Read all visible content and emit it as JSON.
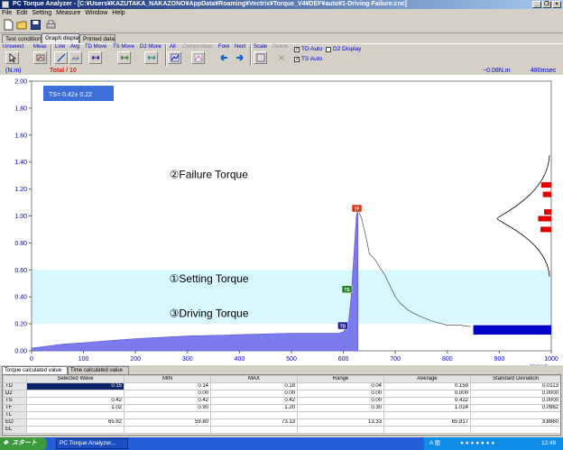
{
  "window": {
    "title": "PC Torque Analyzer - [C:¥Users¥KAZUTAKA_NAKAZONO¥AppData¥Roaming¥Vectrix¥Torque_V4¥DEF¥auto¥1-Driving-Failure.cnc]",
    "minimize": "_",
    "restore": "❐",
    "close": "×"
  },
  "menu": [
    "File",
    "Edit",
    "Setting",
    "Measure",
    "Window",
    "Help"
  ],
  "tabs": [
    {
      "label": "Test condition",
      "active": false
    },
    {
      "label": "Graph display",
      "active": true
    },
    {
      "label": "Printed data",
      "active": false
    }
  ],
  "toolbar2": {
    "unselect": "Unselect",
    "meas": "Meas",
    "line": "Line",
    "avg": "Avg",
    "td_move": "TD Move",
    "ts_move": "TS Move",
    "d2_move": "D2 Move",
    "all": "All",
    "composition": "Composition",
    "fore": "Fore",
    "next": "Next",
    "scale": "Scale",
    "delete": "Delete",
    "td_auto": "TD Auto",
    "d2_display": "D2 Display",
    "ts_auto": "TS Auto"
  },
  "status": {
    "unit": "(N.m)",
    "total": "Total / 10",
    "torque_readout": "−0.08N.m",
    "time_readout": "480msec"
  },
  "chart_data": {
    "type": "area",
    "y_ticks": [
      "2.00",
      "1.80",
      "1.60",
      "1.40",
      "1.20",
      "1.00",
      "0.80",
      "0.60",
      "0.40",
      "0.20",
      "0.00"
    ],
    "x_ticks": [
      "0",
      "100",
      "200",
      "300",
      "400",
      "500",
      "600",
      "700",
      "800",
      "900",
      "1000"
    ],
    "xlim": [
      0,
      1000
    ],
    "ylim": [
      0,
      2
    ],
    "xunit": "(msec)",
    "ts_box_text": "TS=  0.42±  0.22",
    "band": {
      "ymin": 0.2,
      "ymax": 0.6
    },
    "series_fill": [
      [
        0,
        0.02
      ],
      [
        20,
        0.03
      ],
      [
        60,
        0.05
      ],
      [
        100,
        0.06
      ],
      [
        200,
        0.09
      ],
      [
        300,
        0.11
      ],
      [
        400,
        0.12
      ],
      [
        500,
        0.13
      ],
      [
        560,
        0.13
      ],
      [
        590,
        0.13
      ],
      [
        600,
        0.14
      ],
      [
        610,
        0.22
      ],
      [
        615,
        0.4
      ],
      [
        620,
        0.7
      ],
      [
        625,
        1.0
      ],
      [
        628,
        1.05
      ]
    ],
    "series_line": [
      [
        628,
        1.05
      ],
      [
        635,
        0.98
      ],
      [
        645,
        0.82
      ],
      [
        650,
        0.72
      ],
      [
        660,
        0.68
      ],
      [
        670,
        0.62
      ],
      [
        680,
        0.56
      ],
      [
        690,
        0.48
      ],
      [
        700,
        0.4
      ],
      [
        710,
        0.35
      ],
      [
        725,
        0.3
      ],
      [
        745,
        0.26
      ],
      [
        770,
        0.22
      ],
      [
        800,
        0.19
      ],
      [
        825,
        0.19
      ],
      [
        845,
        0.18
      ]
    ],
    "markers": [
      {
        "label": "TF",
        "x": 625,
        "y": 1.05,
        "color": "#e03010"
      },
      {
        "label": "TS",
        "x": 606,
        "y": 0.45,
        "color": "#208020"
      },
      {
        "label": "TD",
        "x": 598,
        "y": 0.18,
        "color": "#1a1aa0"
      }
    ],
    "annotations": [
      {
        "text": "②Failure Torque",
        "x": 265,
        "y": 1.28
      },
      {
        "text": "①Setting Torque",
        "x": 265,
        "y": 0.51
      },
      {
        "text": "③Driving Torque",
        "x": 265,
        "y": 0.25
      }
    ],
    "td_bar": {
      "x0": 850,
      "x1": 1000,
      "y0": 0.12,
      "y1": 0.19
    },
    "histogram": [
      {
        "y": 1.23,
        "w": 0.42
      },
      {
        "y": 1.16,
        "w": 0.35
      },
      {
        "y": 1.03,
        "w": 0.3
      },
      {
        "y": 0.98,
        "w": 0.55
      },
      {
        "y": 0.9,
        "w": 0.45
      }
    ]
  },
  "bottom_tabs": [
    {
      "label": "Torque calculated value",
      "active": true
    },
    {
      "label": "Time calculated value",
      "active": false
    }
  ],
  "table": {
    "headers": [
      "",
      "Selected Wave",
      "MIN",
      "MAX",
      "Range",
      "Average",
      "Standard Deviation"
    ],
    "rows": [
      {
        "name": "TD",
        "cells": [
          "0.15",
          "0.14",
          "0.18",
          "0.04",
          "0.159",
          "0.0113"
        ],
        "selected": true
      },
      {
        "name": "D2",
        "cells": [
          "",
          "0.00",
          "0.00",
          "0.00",
          "0.000",
          "0.0000"
        ]
      },
      {
        "name": "TS",
        "cells": [
          "0.42",
          "0.42",
          "0.42",
          "0.00",
          "0.422",
          "0.0000"
        ]
      },
      {
        "name": "TF",
        "cells": [
          "1.02",
          "0.90",
          "1.20",
          "0.30",
          "1.024",
          "0.0982"
        ]
      },
      {
        "name": "TL",
        "cells": [
          "",
          "",
          "",
          "",
          "",
          ""
        ]
      },
      {
        "name": "EO",
        "cells": [
          "65.92",
          "59.80",
          "73.13",
          "13.33",
          "65.817",
          "3.8860"
        ]
      },
      {
        "name": "EL",
        "cells": [
          "",
          "",
          "",
          "",
          "",
          ""
        ]
      }
    ]
  },
  "taskbar": {
    "start": "スタート",
    "task": "PC Torque Analyzer...",
    "ime": "A 般",
    "clock": "12:48"
  },
  "colors": {
    "fill": "#7b7bee",
    "band": "#d8f7ff",
    "accent": "#3c6fd8"
  }
}
